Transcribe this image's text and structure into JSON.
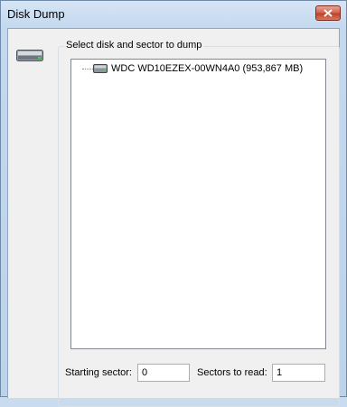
{
  "window": {
    "title": "Disk Dump"
  },
  "group": {
    "label": "Select disk and sector to dump"
  },
  "tree": {
    "items": [
      {
        "label": "WDC WD10EZEX-00WN4A0 (953,867 MB)",
        "icon": "hard-disk-icon"
      }
    ]
  },
  "fields": {
    "starting_sector_label": "Starting sector:",
    "starting_sector_value": "0",
    "sectors_to_read_label": "Sectors to read:",
    "sectors_to_read_value": "1"
  },
  "colors": {
    "close_button": "#c0432a",
    "title_bar": "#c4d8ee",
    "client_background": "#f0f0f0"
  }
}
